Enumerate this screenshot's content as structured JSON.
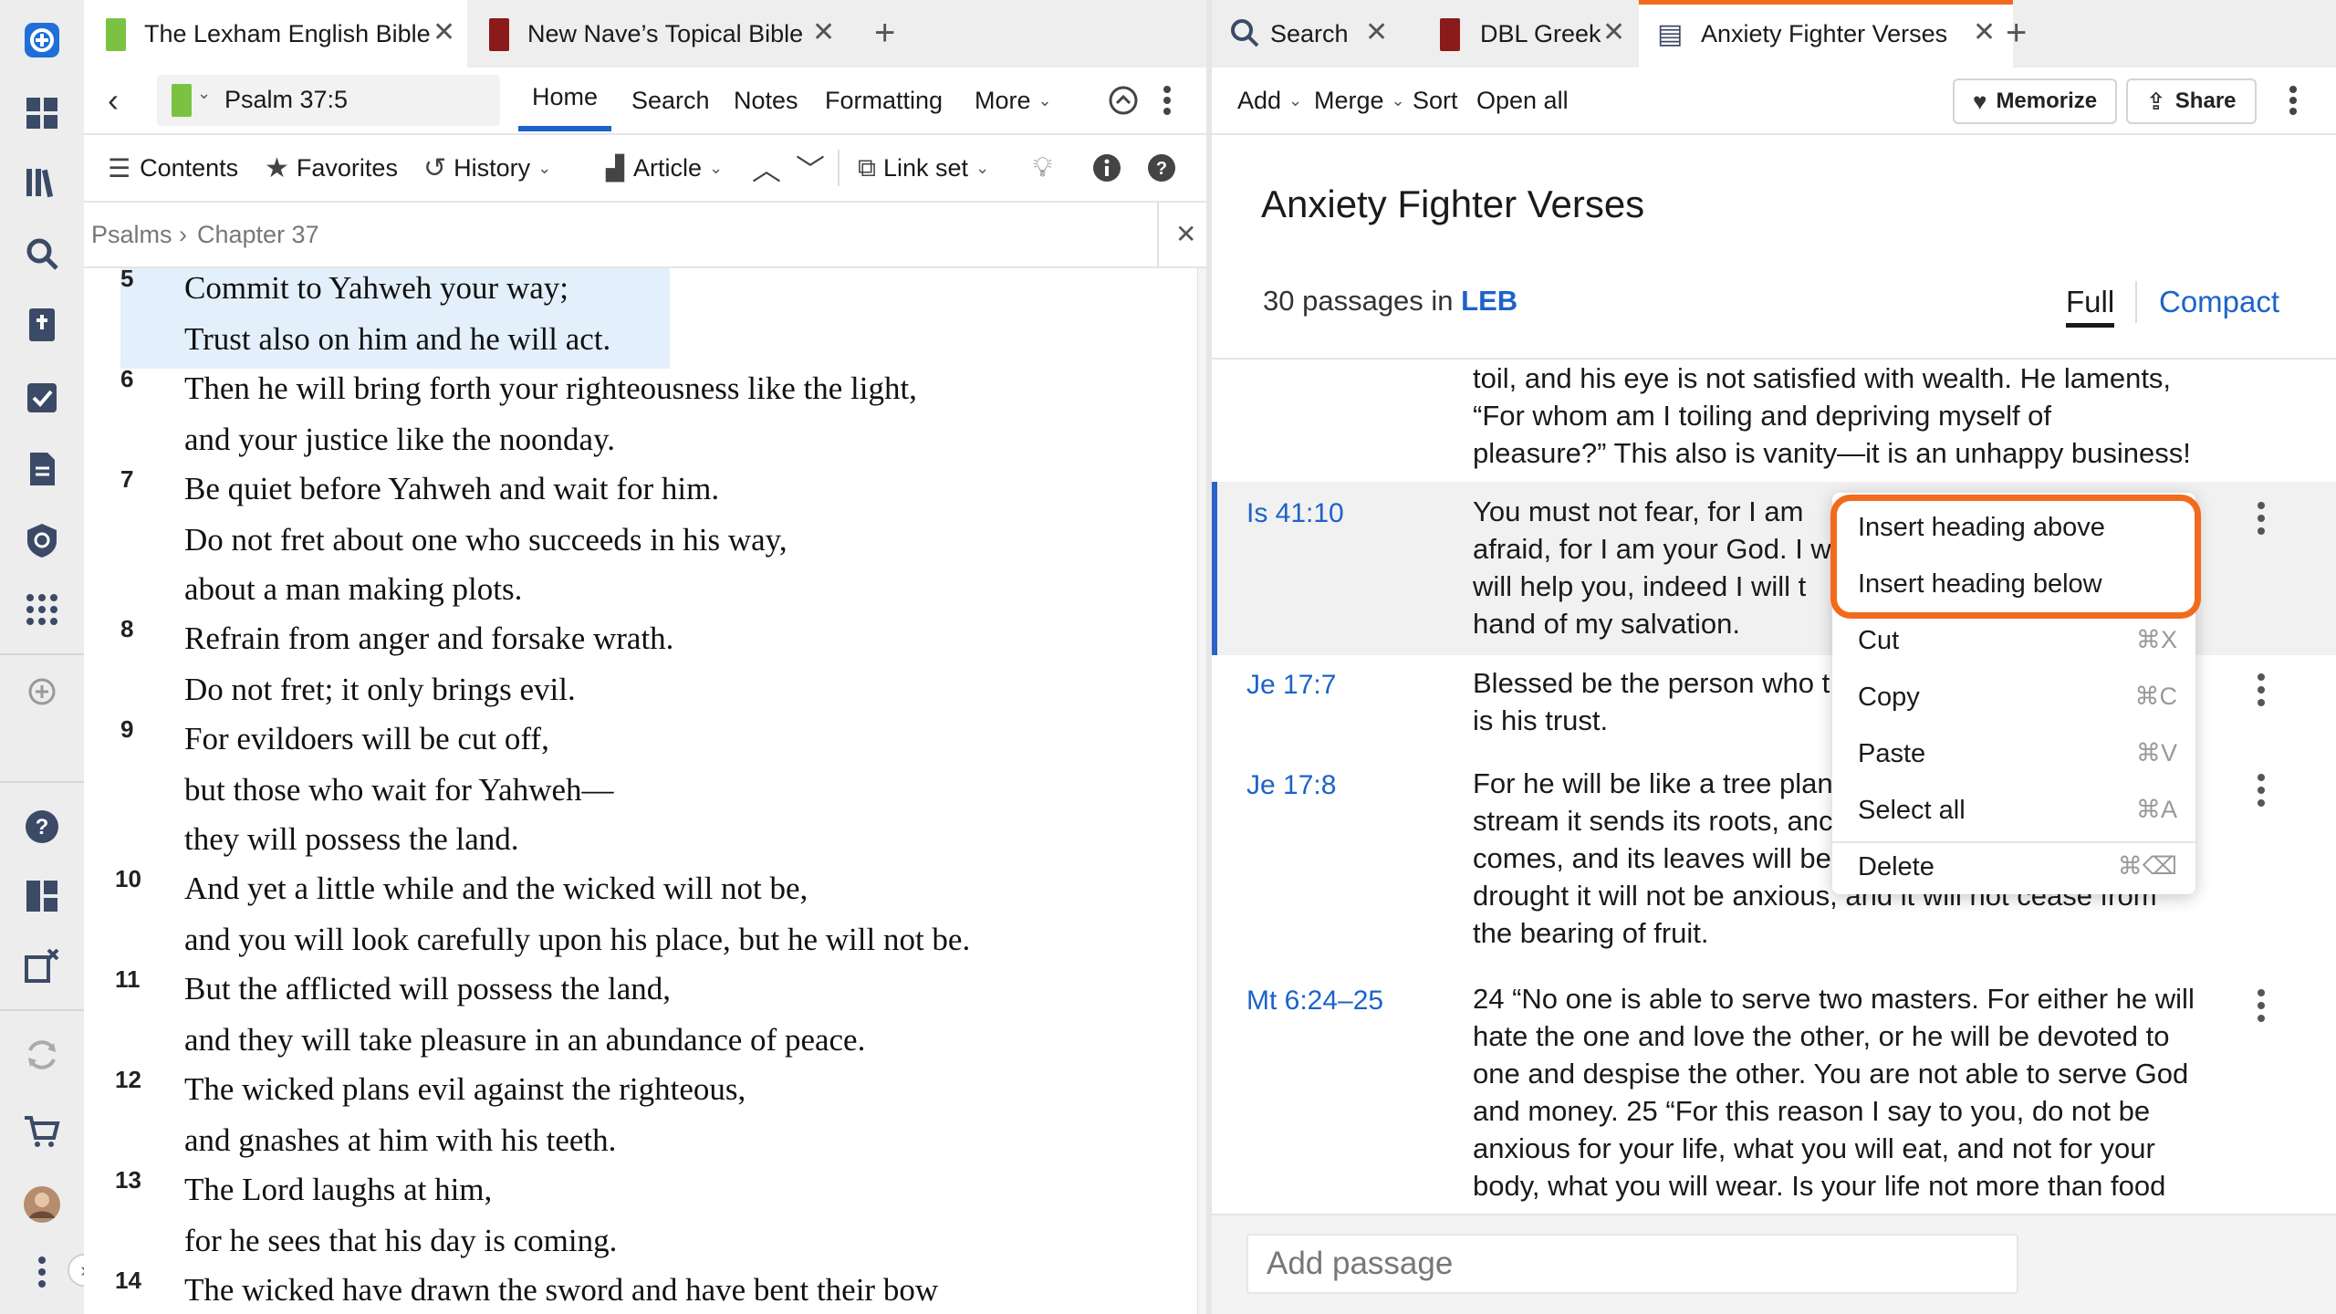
{
  "left_tabs": [
    {
      "label": "The Lexham English Bible",
      "active": true
    },
    {
      "label": "New Nave’s Topical Bible",
      "active": false
    }
  ],
  "right_tabs": [
    {
      "label": "Search",
      "active": false
    },
    {
      "label": "DBL Greek",
      "active": false
    },
    {
      "label": "Anxiety Fighter Verses",
      "active": true
    }
  ],
  "left_toolbar": {
    "reference": "Psalm 37:5",
    "nav": [
      "Home",
      "Search",
      "Notes",
      "Formatting",
      "More"
    ],
    "row2": {
      "contents": "Contents",
      "favorites": "Favorites",
      "history": "History",
      "article": "Article",
      "link_set": "Link set"
    }
  },
  "breadcrumb": {
    "book": "Psalms",
    "sep": "›",
    "chapter": "Chapter 37"
  },
  "verses": [
    {
      "num": "5",
      "line": "Commit to Yahweh your way;"
    },
    {
      "num": "",
      "line": "Trust also on him and he will act."
    },
    {
      "num": "6",
      "line": "Then he will bring forth your righteousness like the light,"
    },
    {
      "num": "",
      "line": "and your justice like the noonday."
    },
    {
      "num": "7",
      "line": "Be quiet before Yahweh and wait for him."
    },
    {
      "num": "",
      "line": "Do not fret about one who succeeds in his way,"
    },
    {
      "num": "",
      "line": "about a man making plots."
    },
    {
      "num": "8",
      "line": "Refrain from anger and forsake wrath."
    },
    {
      "num": "",
      "line": "Do not fret; it only brings evil."
    },
    {
      "num": "9",
      "line": "For evildoers will be cut off,"
    },
    {
      "num": "",
      "line": "but those who wait for Yahweh—"
    },
    {
      "num": "",
      "line": "they will possess the land."
    },
    {
      "num": "10",
      "line": "And yet a little while and the wicked will not be,"
    },
    {
      "num": "",
      "line": "and you will look carefully upon his place, but he will not be."
    },
    {
      "num": "11",
      "line": "But the afflicted will possess the land,"
    },
    {
      "num": "",
      "line": "and they will take pleasure in an abundance of peace."
    },
    {
      "num": "12",
      "line": "The wicked plans evil against the righteous,"
    },
    {
      "num": "",
      "line": "and gnashes at him with his teeth."
    },
    {
      "num": "13",
      "line": "The Lord laughs at him,"
    },
    {
      "num": "",
      "line": "for he sees that his day is coming."
    },
    {
      "num": "14",
      "line": "The wicked have drawn the sword and have bent their bow"
    }
  ],
  "right_toolbar": {
    "add": "Add",
    "merge": "Merge",
    "sort": "Sort",
    "open_all": "Open all",
    "memorize": "Memorize",
    "share": "Share"
  },
  "document": {
    "title": "Anxiety Fighter Verses",
    "count_text": "30 passages in",
    "version": "LEB",
    "view_full": "Full",
    "view_compact": "Compact"
  },
  "passages": [
    {
      "ref": "",
      "lines": [
        "toil, and his eye is not satisfied with wealth. He laments,",
        "“For whom am I toiling and depriving myself of",
        "pleasure?” This also is vanity—it is an unhappy business!"
      ]
    },
    {
      "ref": "Is 41:10",
      "lines": [
        "You must not fear, for I am",
        "afraid, for I am your God. I w",
        "will help you, indeed I will t",
        "hand of my salvation."
      ]
    },
    {
      "ref": "Je 17:7",
      "lines": [
        "Blessed be the person who t",
        "is his trust."
      ]
    },
    {
      "ref": "Je 17:8",
      "lines": [
        "For he will be like a tree plan",
        "stream it sends its roots, anc",
        "comes, and its leaves will be",
        "drought it will not be anxious, and it will not cease from",
        "the bearing of fruit."
      ]
    },
    {
      "ref": "Mt 6:24–25",
      "lines": [
        "24 “No one is able to serve two masters. For either he will",
        "hate the one and love the other, or he will be devoted to",
        "one and despise the other. You are not able to serve God",
        "and money. 25 “For this reason I say to you, do not be",
        "anxious for your life, what you will eat, and not for your",
        "body, what you will wear. Is your life not more than food"
      ]
    }
  ],
  "add_passage_placeholder": "Add passage",
  "context_menu": {
    "items": [
      {
        "label": "Insert heading above",
        "shortcut": ""
      },
      {
        "label": "Insert heading below",
        "shortcut": ""
      },
      {
        "label": "Cut",
        "shortcut": "⌘X"
      },
      {
        "label": "Copy",
        "shortcut": "⌘C"
      },
      {
        "label": "Paste",
        "shortcut": "⌘V"
      },
      {
        "label": "Select all",
        "shortcut": "⌘A"
      },
      {
        "label": "Delete",
        "shortcut": "⌘⌫"
      }
    ]
  },
  "colors": {
    "accent": "#1c63c9",
    "highlight_ring": "#f26b1d",
    "selection": "#e3effa"
  }
}
